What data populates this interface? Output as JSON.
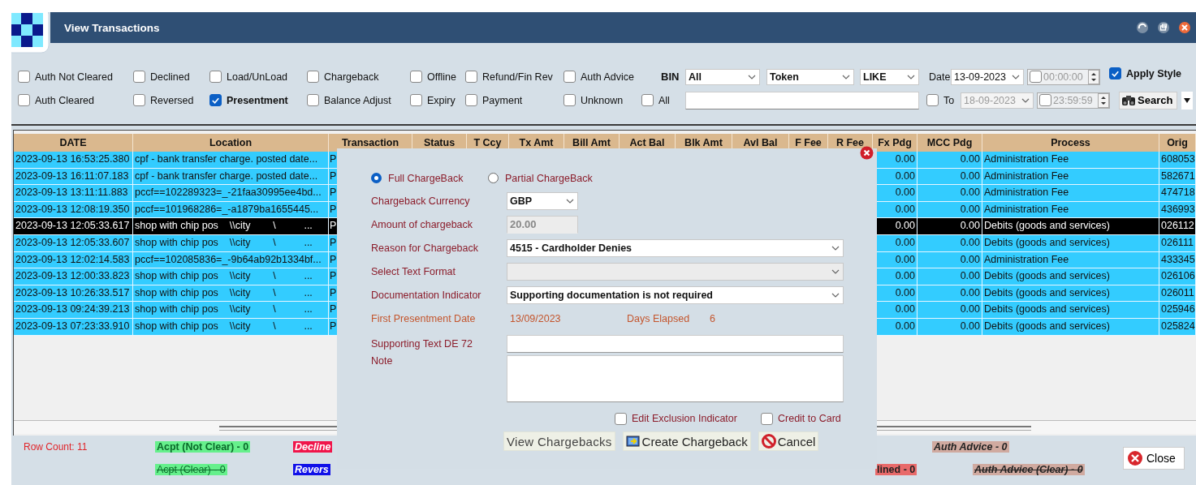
{
  "window": {
    "title": "View Transactions"
  },
  "filters": {
    "rows": [
      [
        {
          "label": "Auth Not Cleared",
          "checked": false
        },
        {
          "label": "Declined",
          "checked": false
        },
        {
          "label": "Load/UnLoad",
          "checked": false
        },
        {
          "label": "Chargeback",
          "checked": false
        },
        {
          "label": "Offline",
          "checked": false
        },
        {
          "label": "Refund/Fin Rev",
          "checked": false
        },
        {
          "label": "Auth Advice",
          "checked": false
        }
      ],
      [
        {
          "label": "Auth Cleared",
          "checked": false
        },
        {
          "label": "Reversed",
          "checked": false
        },
        {
          "label": "Presentment",
          "checked": true
        },
        {
          "label": "Balance Adjust",
          "checked": false
        },
        {
          "label": "Expiry",
          "checked": false
        },
        {
          "label": "Payment",
          "checked": false
        },
        {
          "label": "Unknown",
          "checked": false
        }
      ]
    ]
  },
  "search": {
    "bin_label": "BIN",
    "bin": "All",
    "field": "Token",
    "operator": "LIKE",
    "all": {
      "label": "All",
      "checked": false
    },
    "date_label": "Date",
    "date_from": "13-09-2023",
    "time_from": {
      "value": "00:00:00",
      "checked": false
    },
    "to": {
      "label": "To",
      "checked": false
    },
    "date_to": {
      "value": "18-09-2023",
      "disabled": true
    },
    "time_to": {
      "value": "23:59:59",
      "checked": false
    },
    "apply_style": {
      "label": "Apply Style",
      "checked": true
    },
    "search_button": "Search"
  },
  "table": {
    "columns": [
      "DATE",
      "Location",
      "Transaction",
      "Status",
      "T Ccy",
      "Tx Amt",
      "Bill Amt",
      "Act Bal",
      "Blk Amt",
      "Avl Bal",
      "F Fee",
      "R Fee",
      "Fx Pdg",
      "MCC Pdg",
      "Process",
      "Orig"
    ],
    "rows": [
      {
        "date": "2023-09-13 16:53:25.380",
        "location": "cpf - bank transfer charge. posted date...",
        "transaction": "P",
        "fx_pdg": "0.00",
        "mcc_pdg": "0.00",
        "process": "Administration Fee",
        "orig": "608053",
        "selected": false
      },
      {
        "date": "2023-09-13 16:11:07.183",
        "location": "cpf - bank transfer charge. posted date...",
        "transaction": "P",
        "fx_pdg": "0.00",
        "mcc_pdg": "0.00",
        "process": "Administration Fee",
        "orig": "582671",
        "selected": false
      },
      {
        "date": "2023-09-13 13:11:11.883",
        "location": "pccf==102289323=_-21faa30995ee4bd...",
        "transaction": "P",
        "fx_pdg": "0.00",
        "mcc_pdg": "0.00",
        "process": "Administration Fee",
        "orig": "474718",
        "selected": false
      },
      {
        "date": "2023-09-13 12:08:19.350",
        "location": "pccf==101968286=_-a1879ba1655445...",
        "transaction": "P",
        "fx_pdg": "0.00",
        "mcc_pdg": "0.00",
        "process": "Administration Fee",
        "orig": "436993",
        "selected": false
      },
      {
        "date": "2023-09-13 12:05:33.617",
        "location": "shop with chip pos    \\\\city        \\          ...",
        "transaction": "P",
        "fx_pdg": "0.00",
        "mcc_pdg": "0.00",
        "process": "Debits (goods and services)",
        "orig": "026112",
        "selected": true
      },
      {
        "date": "2023-09-13 12:05:33.607",
        "location": "shop with chip pos    \\\\city        \\          ...",
        "transaction": "P",
        "fx_pdg": "0.00",
        "mcc_pdg": "0.00",
        "process": "Debits (goods and services)",
        "orig": "026111",
        "selected": false
      },
      {
        "date": "2023-09-13 12:02:14.583",
        "location": "pccf==102085836=_-9b64ab92b1334bf...",
        "transaction": "P",
        "fx_pdg": "0.00",
        "mcc_pdg": "0.00",
        "process": "Administration Fee",
        "orig": "433345",
        "selected": false
      },
      {
        "date": "2023-09-13 12:00:33.823",
        "location": "shop with chip pos    \\\\city        \\          ...",
        "transaction": "P",
        "fx_pdg": "0.00",
        "mcc_pdg": "0.00",
        "process": "Debits (goods and services)",
        "orig": "026106",
        "selected": false
      },
      {
        "date": "2023-09-13 10:26:33.517",
        "location": "shop with chip pos    \\\\city        \\          ...",
        "transaction": "P",
        "fx_pdg": "0.00",
        "mcc_pdg": "0.00",
        "process": "Debits (goods and services)",
        "orig": "026011",
        "selected": false
      },
      {
        "date": "2023-09-13 09:24:39.213",
        "location": "shop with chip pos    \\\\city        \\          ...",
        "transaction": "P",
        "fx_pdg": "0.00",
        "mcc_pdg": "0.00",
        "process": "Debits (goods and services)",
        "orig": "025946",
        "selected": false
      },
      {
        "date": "2023-09-13 07:23:33.910",
        "location": "shop with chip pos    \\\\city        \\          ...",
        "transaction": "P",
        "fx_pdg": "0.00",
        "mcc_pdg": "0.00",
        "process": "Debits (goods and services)",
        "orig": "025824",
        "selected": false
      }
    ]
  },
  "footer": {
    "row_count": "Row Count: 11",
    "legend": [
      {
        "label": "Acpt (Not Clear) - 0",
        "kind": "accept",
        "color": "#66f08c",
        "struck": false
      },
      {
        "label": "Decline",
        "kind": "alert",
        "color": "#f0154a",
        "struck": false
      },
      {
        "label": "Auth Advice - 0",
        "kind": "advice",
        "color": "#d0aaa0",
        "struck": false
      },
      {
        "label": "Acpt (Clear) - 0",
        "kind": "accept",
        "color": "#66f08c",
        "struck": true
      },
      {
        "label": "Revers",
        "kind": "alert",
        "color": "#1010e8",
        "struck": false
      },
      {
        "label": "lined - 0",
        "kind": "plain",
        "color": "#e86a6a",
        "struck": false
      },
      {
        "label": "Auth Advice (Clear) - 0",
        "kind": "advice",
        "color": "#d0aaa0",
        "struck": true
      }
    ],
    "close_button": "Close"
  },
  "dialog": {
    "options": [
      {
        "label": "Full ChargeBack",
        "selected": true
      },
      {
        "label": "Partial ChargeBack",
        "selected": false
      }
    ],
    "fields": [
      {
        "kind": "short_select",
        "label": "Chargeback Currency",
        "value": "GBP",
        "disabled": false
      },
      {
        "kind": "short_input",
        "label": "Amount of chargeback",
        "value": "20.00",
        "disabled": true
      },
      {
        "kind": "select",
        "label": "Reason for Chargeback",
        "value": "4515 - Cardholder Denies",
        "disabled": false
      },
      {
        "kind": "select",
        "label": "Select Text Format",
        "disabled": true
      },
      {
        "kind": "select",
        "label": "Documentation Indicator",
        "value": "Supporting documentation is not required",
        "disabled": false
      },
      {
        "kind": "info",
        "label": "First Presentment Date",
        "value": "13/09/2023",
        "extra_label": "Days Elapsed",
        "extra_value": "6"
      },
      {
        "kind": "input",
        "label": "Supporting Text DE 72",
        "disabled": false
      },
      {
        "kind": "textarea",
        "label": "Note",
        "disabled": false
      }
    ],
    "checkboxes": [
      {
        "label": "Edit Exclusion Indicator",
        "checked": false
      },
      {
        "label": "Credit to Card",
        "checked": false
      }
    ],
    "buttons": [
      {
        "label": "View Chargebacks",
        "kind": "plain"
      },
      {
        "label": "Create Chargeback",
        "kind": "create"
      },
      {
        "label": "Cancel",
        "kind": "cancel"
      }
    ]
  }
}
